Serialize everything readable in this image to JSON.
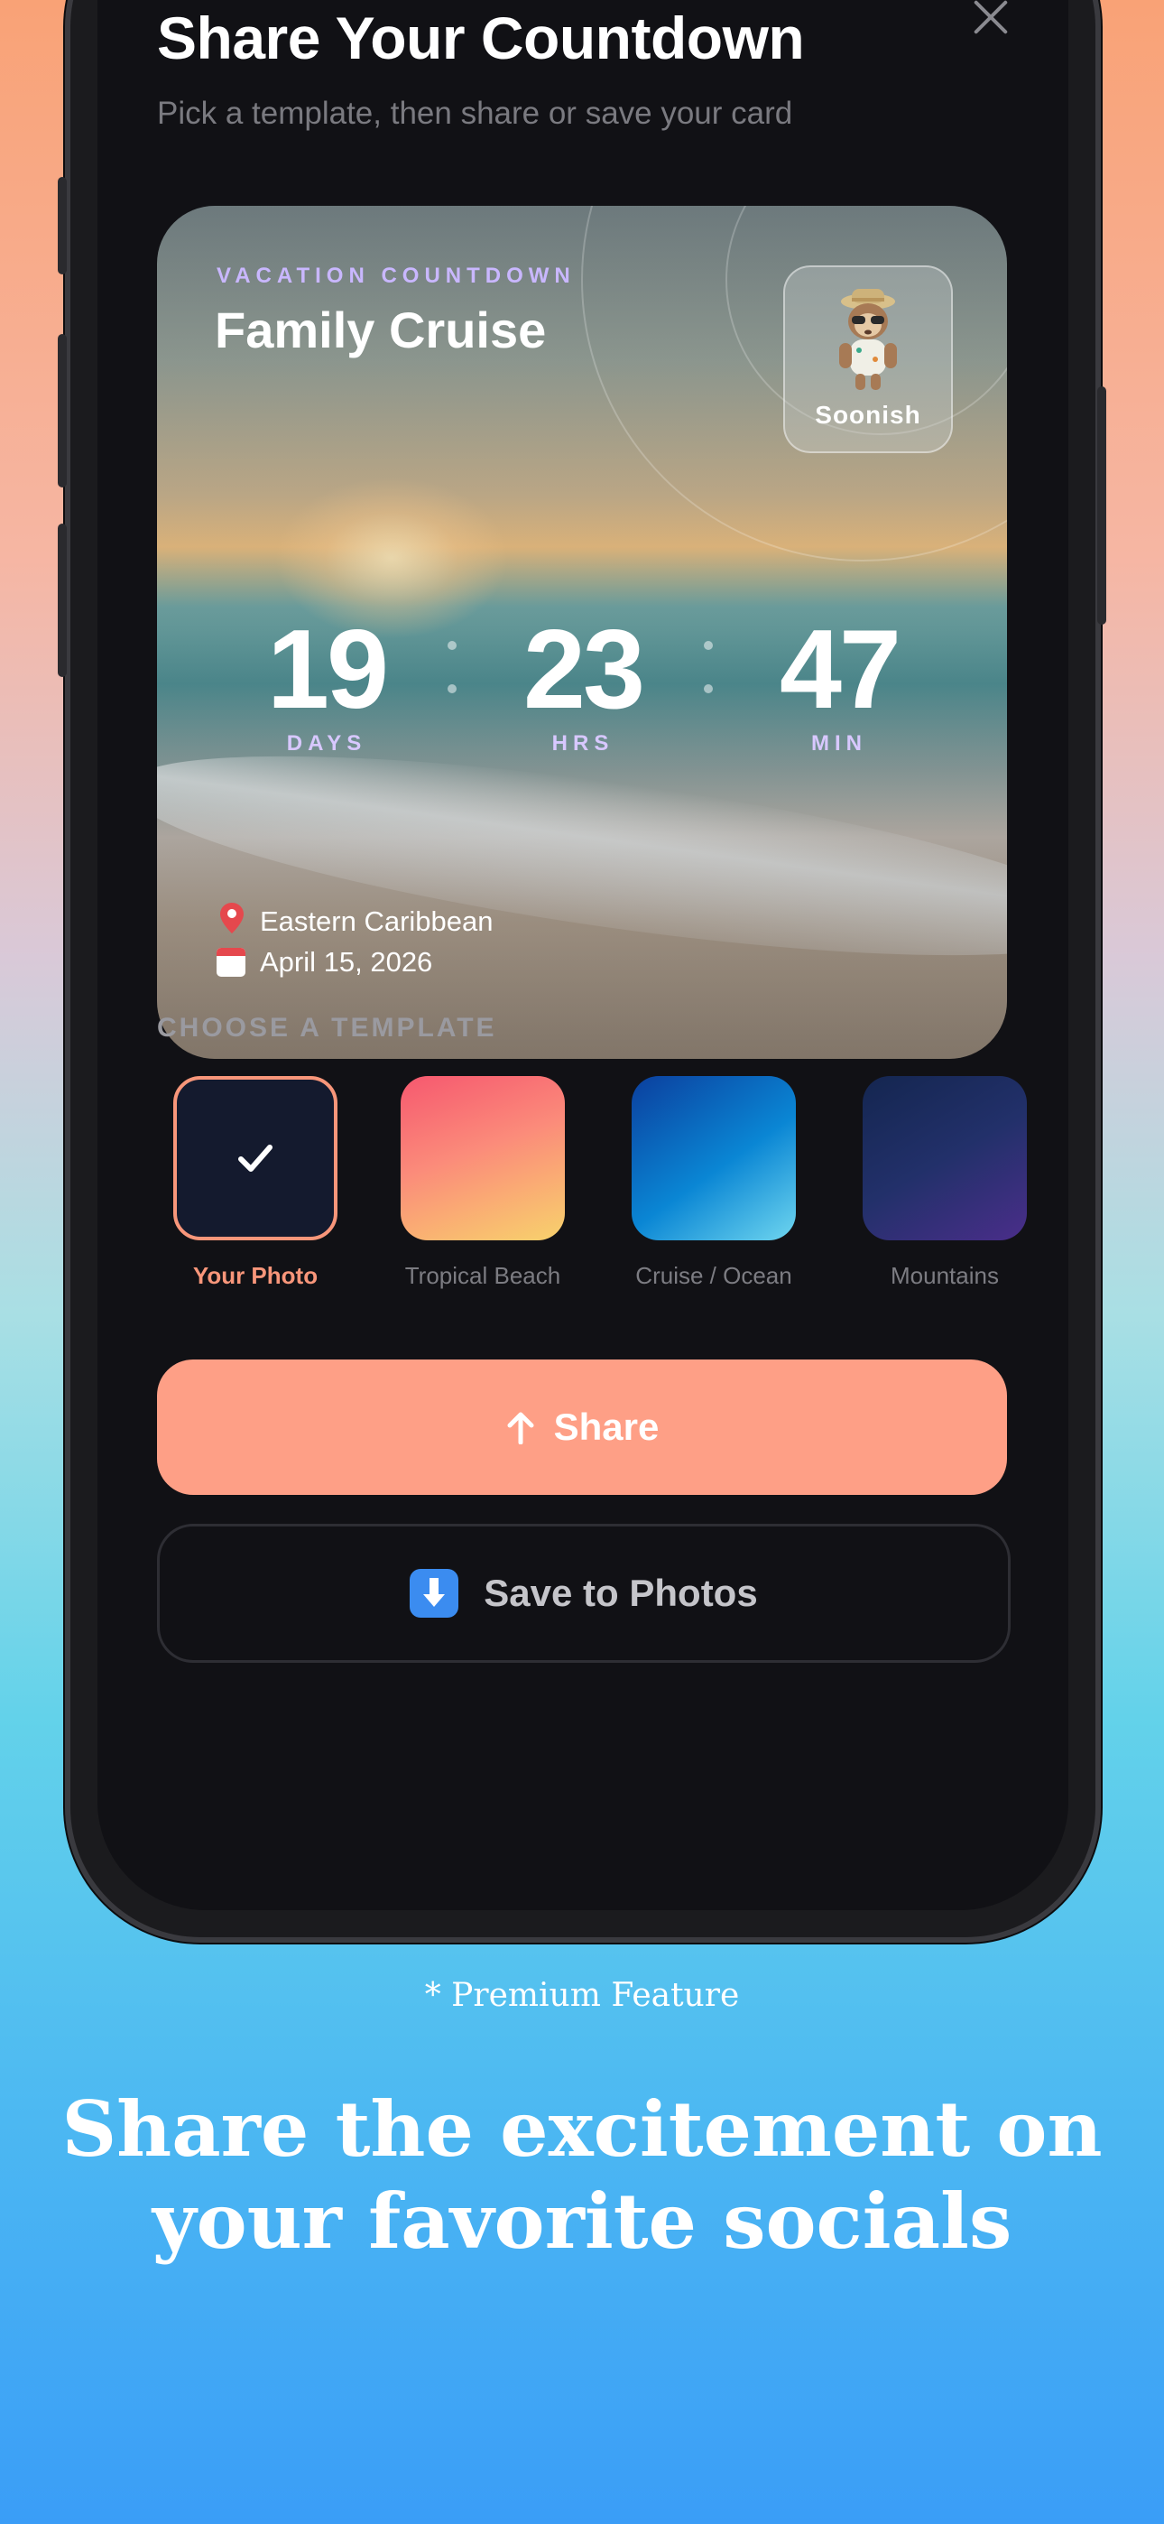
{
  "sheet": {
    "title": "Share Your Countdown",
    "subtitle": "Pick a template, then share or save your card"
  },
  "card": {
    "kicker": "VACATION COUNTDOWN",
    "title": "Family Cruise",
    "badge_label": "Soonish",
    "countdown": [
      {
        "value": "19",
        "unit": "DAYS"
      },
      {
        "value": "23",
        "unit": "HRS"
      },
      {
        "value": "47",
        "unit": "MIN"
      }
    ],
    "location": "Eastern Caribbean",
    "date": "April 15, 2026",
    "location_icon": "pin-icon",
    "date_icon": "calendar-icon"
  },
  "templates": {
    "section_label": "CHOOSE A TEMPLATE",
    "items": [
      {
        "label": "Your Photo",
        "selected": true
      },
      {
        "label": "Tropical Beach",
        "selected": false
      },
      {
        "label": "Cruise / Ocean",
        "selected": false
      },
      {
        "label": "Mountains",
        "selected": false
      }
    ]
  },
  "actions": {
    "share_label": "Share",
    "save_label": "Save to Photos"
  },
  "footer": {
    "premium_note": "* Premium Feature",
    "headline": "Share the excitement on your favorite socials"
  },
  "colors": {
    "accent": "#fe9f86",
    "sheet_bg": "#111115",
    "kicker": "#c9b7ff"
  }
}
